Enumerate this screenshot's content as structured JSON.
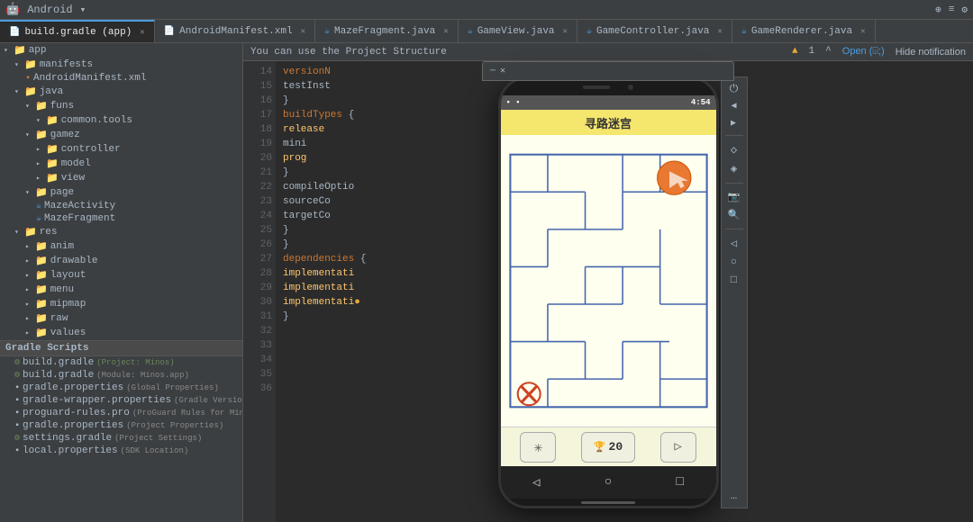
{
  "topbar": {
    "project_name": "Android",
    "dropdown_icon": "▾"
  },
  "tabbar": {
    "tabs": [
      {
        "id": "build-gradle-app",
        "label": "build.gradle (app)",
        "type": "gradle",
        "active": true
      },
      {
        "id": "androidmanifest",
        "label": "AndroidManifest.xml",
        "type": "xml",
        "active": false
      },
      {
        "id": "mazefragment",
        "label": "MazeFragment.java",
        "type": "java",
        "active": false
      },
      {
        "id": "gameview",
        "label": "GameView.java",
        "type": "java",
        "active": false
      },
      {
        "id": "gamecontroller",
        "label": "GameController.java",
        "type": "java",
        "active": false
      },
      {
        "id": "gamerenderer",
        "label": "GameRenderer.java",
        "type": "java",
        "active": false
      }
    ]
  },
  "sidebar": {
    "title": "app",
    "items": [
      {
        "label": "manifests",
        "type": "folder",
        "indent": 1
      },
      {
        "label": "AndroidManifest.xml",
        "type": "xml",
        "indent": 2
      },
      {
        "label": "java",
        "type": "folder",
        "indent": 1
      },
      {
        "label": "funs",
        "type": "folder",
        "indent": 2
      },
      {
        "label": "common.tools",
        "type": "folder",
        "indent": 3
      },
      {
        "label": "gamez",
        "type": "folder",
        "indent": 2
      },
      {
        "label": "controller",
        "type": "folder",
        "indent": 3
      },
      {
        "label": "model",
        "type": "folder",
        "indent": 3
      },
      {
        "label": "view",
        "type": "folder",
        "indent": 3
      },
      {
        "label": "page",
        "type": "folder",
        "indent": 2
      },
      {
        "label": "MazeActivity",
        "type": "java",
        "indent": 3
      },
      {
        "label": "MazeFragment",
        "type": "java",
        "indent": 3
      },
      {
        "label": "res",
        "type": "folder",
        "indent": 1
      },
      {
        "label": "anim",
        "type": "folder",
        "indent": 2
      },
      {
        "label": "drawable",
        "type": "folder",
        "indent": 2
      },
      {
        "label": "layout",
        "type": "folder",
        "indent": 2
      },
      {
        "label": "menu",
        "type": "folder",
        "indent": 2
      },
      {
        "label": "mipmap",
        "type": "folder",
        "indent": 2
      },
      {
        "label": "raw",
        "type": "folder",
        "indent": 2
      },
      {
        "label": "values",
        "type": "folder",
        "indent": 2
      }
    ],
    "gradle_section": "Gradle Scripts",
    "gradle_items": [
      {
        "label": "build.gradle",
        "badge": "(Project: Minos)",
        "type": "gradle",
        "indent": 1
      },
      {
        "label": "build.gradle",
        "badge": "(Module: Minos.app)",
        "type": "gradle",
        "indent": 1
      },
      {
        "label": "gradle.properties",
        "badge": "(Global Properties)",
        "type": "props",
        "indent": 1
      },
      {
        "label": "gradle-wrapper.properties",
        "badge": "(Gradle Version)",
        "type": "props",
        "indent": 1
      },
      {
        "label": "proguard-rules.pro",
        "badge": "(ProGuard Rules for Minos.app)",
        "type": "props",
        "indent": 1
      },
      {
        "label": "gradle.properties",
        "badge": "(Project Properties)",
        "type": "props",
        "indent": 1
      },
      {
        "label": "settings.gradle",
        "badge": "(Project Settings)",
        "type": "gradle",
        "indent": 1
      },
      {
        "label": "local.properties",
        "badge": "(SDK Location)",
        "type": "props",
        "indent": 1
      }
    ]
  },
  "notification": {
    "text": "You can use the Project Structure"
  },
  "code": {
    "lines": [
      {
        "num": "14",
        "content": "    versionN"
      },
      {
        "num": "15",
        "content": ""
      },
      {
        "num": "16",
        "content": "    testInst"
      },
      {
        "num": "17",
        "content": "}"
      },
      {
        "num": "18",
        "content": ""
      },
      {
        "num": "19",
        "content": "buildTypes {"
      },
      {
        "num": "20",
        "content": "    release"
      },
      {
        "num": "21",
        "content": "        mini"
      },
      {
        "num": "22",
        "content": "        prog"
      },
      {
        "num": "23",
        "content": "    }"
      },
      {
        "num": "24",
        "content": ""
      },
      {
        "num": "25",
        "content": "    compileOptio"
      },
      {
        "num": "26",
        "content": "        sourceCo"
      },
      {
        "num": "27",
        "content": "        targetCo"
      },
      {
        "num": "28",
        "content": "    }"
      },
      {
        "num": "29",
        "content": "}"
      },
      {
        "num": "30",
        "content": ""
      },
      {
        "num": "31",
        "content": "dependencies {"
      },
      {
        "num": "32",
        "content": ""
      },
      {
        "num": "33",
        "content": "    implementati"
      },
      {
        "num": "34",
        "content": "    implementati"
      },
      {
        "num": "35",
        "content": "    implementati"
      },
      {
        "num": "36",
        "content": "}"
      }
    ]
  },
  "emulator": {
    "title": "",
    "close_btn": "✕",
    "minimize_btn": "─"
  },
  "phone": {
    "status_left": "▪ ▪",
    "status_right": "4:54",
    "app_title": "寻路迷宫",
    "score": "20",
    "nav_back": "◁",
    "nav_home": "○",
    "nav_recent": "□",
    "ctrl_settings": "✳",
    "ctrl_play": "▷"
  },
  "notification_bar": {
    "open_label": "Open (⌹;)",
    "hide_label": "Hide notification",
    "warning_count": "▲ 1",
    "caret": "^"
  },
  "right_panel": {
    "buttons": [
      {
        "icon": "⏻",
        "name": "power-icon"
      },
      {
        "icon": "◀",
        "name": "volume-down-icon"
      },
      {
        "icon": "▲",
        "name": "volume-up-icon"
      },
      {
        "icon": "◆",
        "name": "diamond-icon"
      },
      {
        "icon": "◆",
        "name": "diamond-outline-icon"
      },
      {
        "icon": "📷",
        "name": "camera-icon"
      },
      {
        "icon": "🔍",
        "name": "zoom-icon"
      },
      {
        "icon": "◁",
        "name": "back-icon"
      },
      {
        "icon": "○",
        "name": "home-icon"
      },
      {
        "icon": "□",
        "name": "recent-icon"
      },
      {
        "icon": "…",
        "name": "more-icon"
      }
    ]
  }
}
